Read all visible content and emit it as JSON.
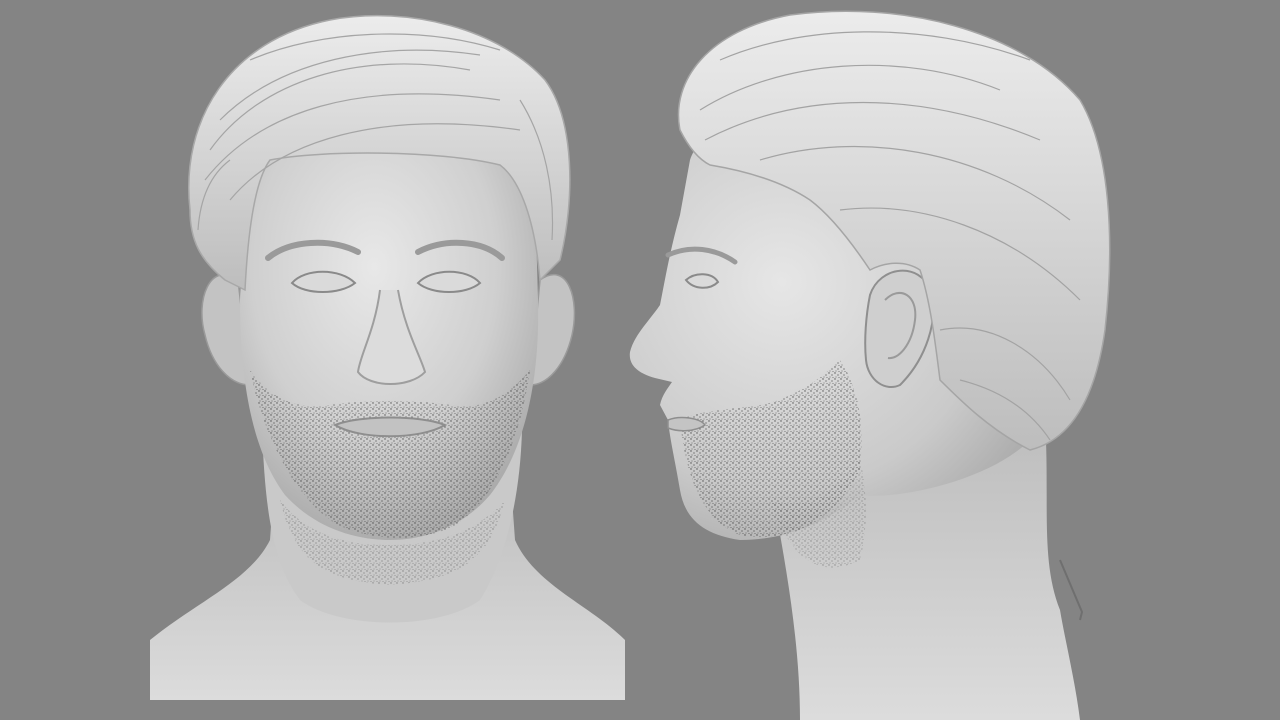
{
  "scene": {
    "background_color": "#848484",
    "material_color": "#d6d6d6",
    "shadow_color": "#8f8f8f",
    "stubble_color": "#3a3a3a",
    "views": [
      {
        "id": "front",
        "kind": "front-view"
      },
      {
        "id": "side",
        "kind": "right-profile-view"
      }
    ]
  }
}
